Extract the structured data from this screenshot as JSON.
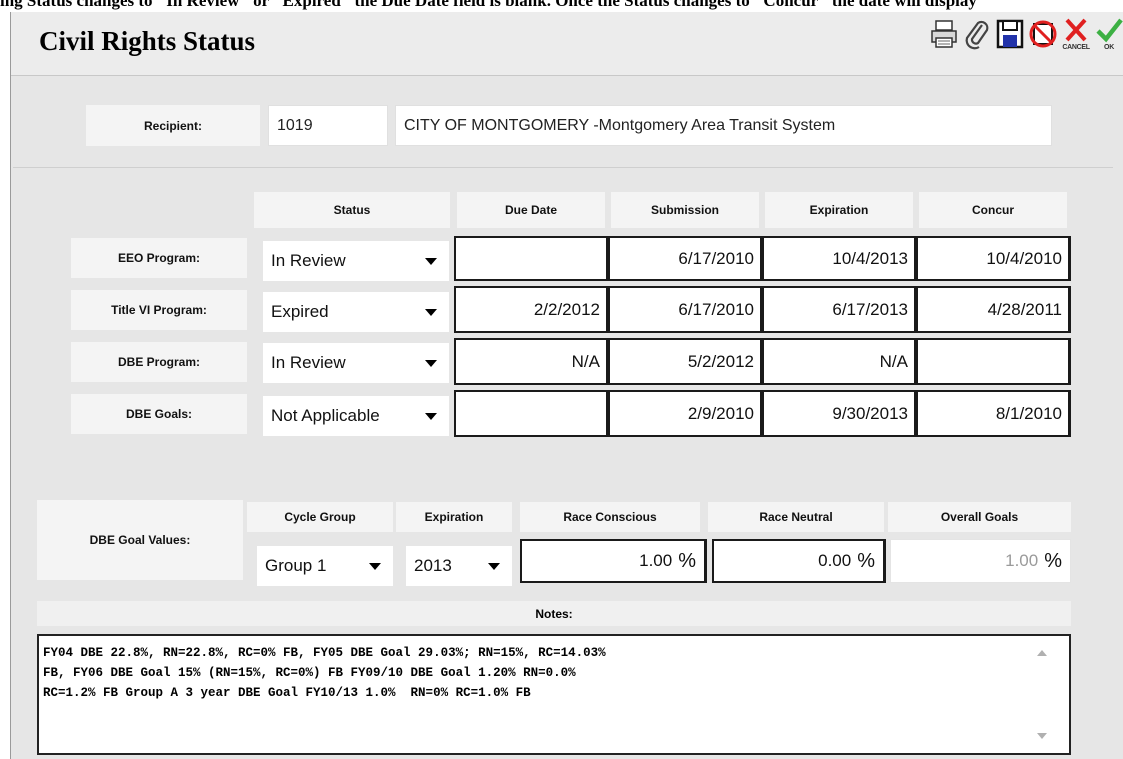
{
  "top_strip_text": "ing Status changes to \"In Review\" or \"Expired\" the Due Date field is blank. Once the Status changes to \"Concur\" the date will display",
  "window": {
    "title": "Civil Rights Status"
  },
  "toolbar": {
    "cancel_label": "CANCEL",
    "ok_label": "OK",
    "save_label": "SAVE"
  },
  "recipient": {
    "label": "Recipient:",
    "id": "1019",
    "name": "CITY OF MONTGOMERY -Montgomery Area Transit System"
  },
  "columns": [
    "Status",
    "Due Date",
    "Submission",
    "Expiration",
    "Concur"
  ],
  "programs": [
    {
      "label": "EEO Program:",
      "status": "In Review",
      "due": "",
      "submission": "6/17/2010",
      "expiration": "10/4/2013",
      "concur": "10/4/2010"
    },
    {
      "label": "Title VI Program:",
      "status": "Expired",
      "due": "2/2/2012",
      "submission": "6/17/2010",
      "expiration": "6/17/2013",
      "concur": "4/28/2011"
    },
    {
      "label": "DBE Program:",
      "status": "In Review",
      "due": "N/A",
      "submission": "5/2/2012",
      "expiration": "N/A",
      "concur": ""
    },
    {
      "label": "DBE Goals:",
      "status": "Not Applicable",
      "due": "",
      "submission": "2/9/2010",
      "expiration": "9/30/2013",
      "concur": "8/1/2010"
    }
  ],
  "goals": {
    "label": "DBE Goal Values:",
    "headers": {
      "cycle": "Cycle Group",
      "expiration": "Expiration",
      "race_conscious": "Race Conscious",
      "race_neutral": "Race Neutral",
      "overall": "Overall Goals"
    },
    "cycle_group": "Group 1",
    "expiration": "2013",
    "race_conscious": "1.00",
    "race_neutral": "0.00",
    "overall": "1.00",
    "unit": "%"
  },
  "notes": {
    "label": "Notes:",
    "text": "FY04 DBE 22.8%, RN=22.8%, RC=0% FB, FY05 DBE Goal 29.03%; RN=15%, RC=14.03%\nFB, FY06 DBE Goal 15% (RN=15%, RC=0%) FB FY09/10 DBE Goal 1.20% RN=0.0%\nRC=1.2% FB Group A 3 year DBE Goal FY10/13 1.0%  RN=0% RC=1.0% FB"
  },
  "colors": {
    "window_bg": "#e6e6e6",
    "label_bg": "#f4f4f4",
    "ok_green": "#3cb043",
    "cancel_red": "#e02020",
    "save_blue": "#2233aa"
  }
}
